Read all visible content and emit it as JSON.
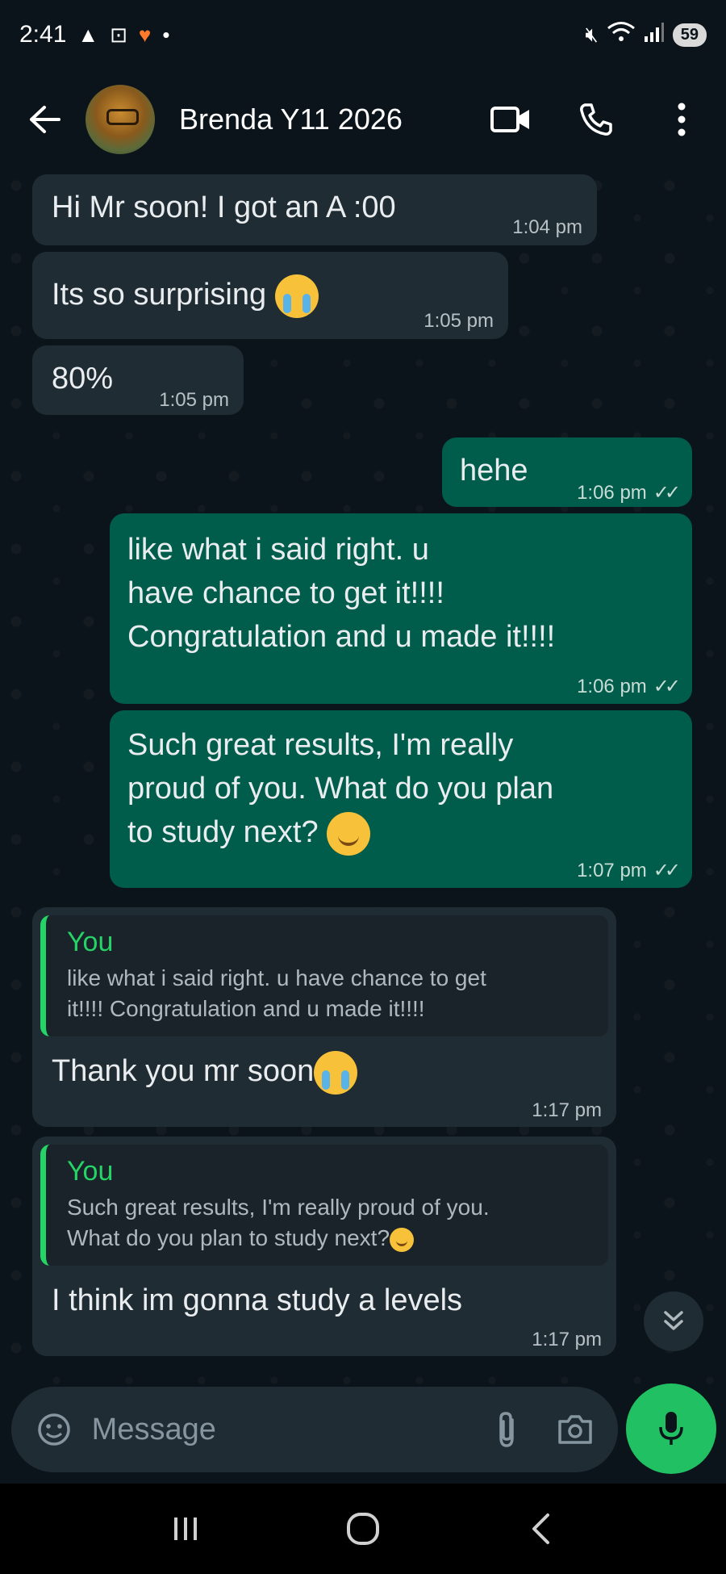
{
  "status_bar": {
    "time": "2:41",
    "battery": "59"
  },
  "header": {
    "contact_name": "Brenda Y11 2026"
  },
  "messages": [
    {
      "id": "m1",
      "dir": "in",
      "text": "Hi Mr soon! I got an A :00",
      "time": "1:04 pm"
    },
    {
      "id": "m2",
      "dir": "in",
      "text": "Its so surprising",
      "emoji": "loudly-crying-face",
      "time": "1:05 pm"
    },
    {
      "id": "m3",
      "dir": "in",
      "text": "80%",
      "time": "1:05 pm"
    },
    {
      "id": "m4",
      "dir": "out",
      "text": "hehe",
      "time": "1:06 pm"
    },
    {
      "id": "m5",
      "dir": "out",
      "lines": [
        "like what i said right. u",
        "have chance to get it!!!!",
        "Congratulation and u made it!!!!"
      ],
      "time": "1:06 pm"
    },
    {
      "id": "m6",
      "dir": "out",
      "lines": [
        "Such great results, I'm really",
        "proud of you. What do you plan",
        "to study next?"
      ],
      "emoji": "smiling-face",
      "time": "1:07 pm"
    },
    {
      "id": "m7",
      "dir": "in",
      "quote": {
        "author": "You",
        "lines": [
          "like what i said right. u have chance to get",
          "it!!!! Congratulation and u made it!!!!"
        ]
      },
      "text": "Thank you mr soon",
      "emoji": "loudly-crying-face",
      "time": "1:17 pm"
    },
    {
      "id": "m8",
      "dir": "in",
      "quote": {
        "author": "You",
        "lines": [
          "Such great results, I'm really proud of you.",
          "What do you plan to study next?"
        ],
        "emoji": "smiling-face"
      },
      "text": "I think im gonna study a levels",
      "time": "1:17 pm"
    }
  ],
  "composer": {
    "placeholder": "Message"
  },
  "icons": {
    "back": "arrow-left-icon",
    "video": "video-camera-icon",
    "call": "phone-icon",
    "more": "more-vertical-icon",
    "emoji": "emoji-sticker-icon",
    "attach": "paperclip-icon",
    "camera": "camera-icon",
    "mic": "microphone-icon",
    "scroll": "double-chevron-down-icon"
  },
  "colors": {
    "background": "#0b141a",
    "incoming_bubble": "#202c33",
    "outgoing_bubble": "#005c4b",
    "accent": "#25d366",
    "mic_button": "#21c063"
  }
}
